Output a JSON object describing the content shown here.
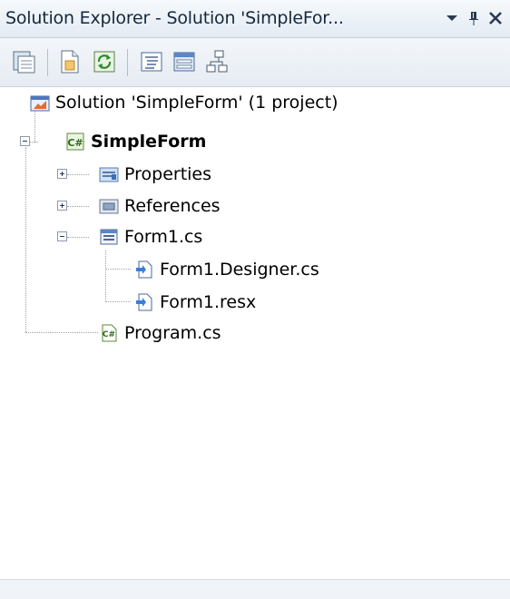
{
  "window": {
    "title": "Solution Explorer - Solution 'SimpleFor...",
    "controls": [
      "dropdown-icon",
      "pin-icon",
      "close-icon"
    ]
  },
  "toolbar": {
    "buttons": [
      {
        "icon": "properties-icon",
        "tooltip": ""
      },
      {
        "icon": "show-all-files-icon",
        "tooltip": ""
      },
      {
        "icon": "refresh-icon",
        "tooltip": ""
      },
      {
        "icon": "view-code-icon",
        "tooltip": ""
      },
      {
        "icon": "view-designer-icon",
        "tooltip": ""
      },
      {
        "icon": "class-diagram-icon",
        "tooltip": ""
      }
    ]
  },
  "tree": {
    "solution": {
      "label": "Solution 'SimpleForm' (1 project)",
      "icon": "solution-icon"
    },
    "project": {
      "label": "SimpleForm",
      "icon": "csharp-project-icon",
      "expanded": true
    },
    "items": [
      {
        "label": "Properties",
        "icon": "properties-folder-icon",
        "expanded": false
      },
      {
        "label": "References",
        "icon": "references-folder-icon",
        "expanded": false
      },
      {
        "label": "Form1.cs",
        "icon": "form-file-icon",
        "expanded": true
      },
      {
        "label": "Form1.Designer.cs",
        "icon": "code-file-icon"
      },
      {
        "label": "Form1.resx",
        "icon": "resource-file-icon"
      },
      {
        "label": "Program.cs",
        "icon": "csharp-file-icon"
      }
    ]
  },
  "colors": {
    "title_text": "#15283d",
    "toolbar_bg": "#e6ecf3",
    "tree_bg": "#ffffff",
    "tree_lines": "#9aa3ad"
  }
}
